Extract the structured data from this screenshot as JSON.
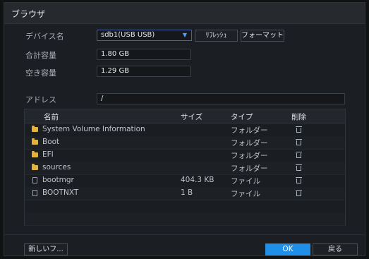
{
  "window": {
    "title": "ブラウザ"
  },
  "device": {
    "label": "デバイス名",
    "selected": "sdb1(USB USB)",
    "refresh_label": "ﾘﾌﾚｯｼｭ",
    "format_label": "フォーマット"
  },
  "capacity": {
    "total_label": "合計容量",
    "total_value": "1.80 GB",
    "free_label": "空き容量",
    "free_value": "1.29 GB"
  },
  "address": {
    "label": "アドレス",
    "value": "/"
  },
  "table": {
    "columns": [
      "名前",
      "サイズ",
      "タイプ",
      "削除"
    ],
    "rows": [
      {
        "name": "System Volume Information",
        "size": "",
        "type": "フォルダー",
        "icon": "folder-icon"
      },
      {
        "name": "Boot",
        "size": "",
        "type": "フォルダー",
        "icon": "folder-icon"
      },
      {
        "name": "EFI",
        "size": "",
        "type": "フォルダー",
        "icon": "folder-icon"
      },
      {
        "name": "sources",
        "size": "",
        "type": "フォルダー",
        "icon": "folder-icon"
      },
      {
        "name": "bootmgr",
        "size": "404.3 KB",
        "type": "ファイル",
        "icon": "file-icon"
      },
      {
        "name": "BOOTNXT",
        "size": "1 B",
        "type": "ファイル",
        "icon": "file-icon"
      }
    ]
  },
  "footer": {
    "new_folder_label": "新しいフ...",
    "ok_label": "OK",
    "back_label": "戻る"
  },
  "colors": {
    "accent": "#1f8fe8",
    "folder": "#e3b23c"
  }
}
